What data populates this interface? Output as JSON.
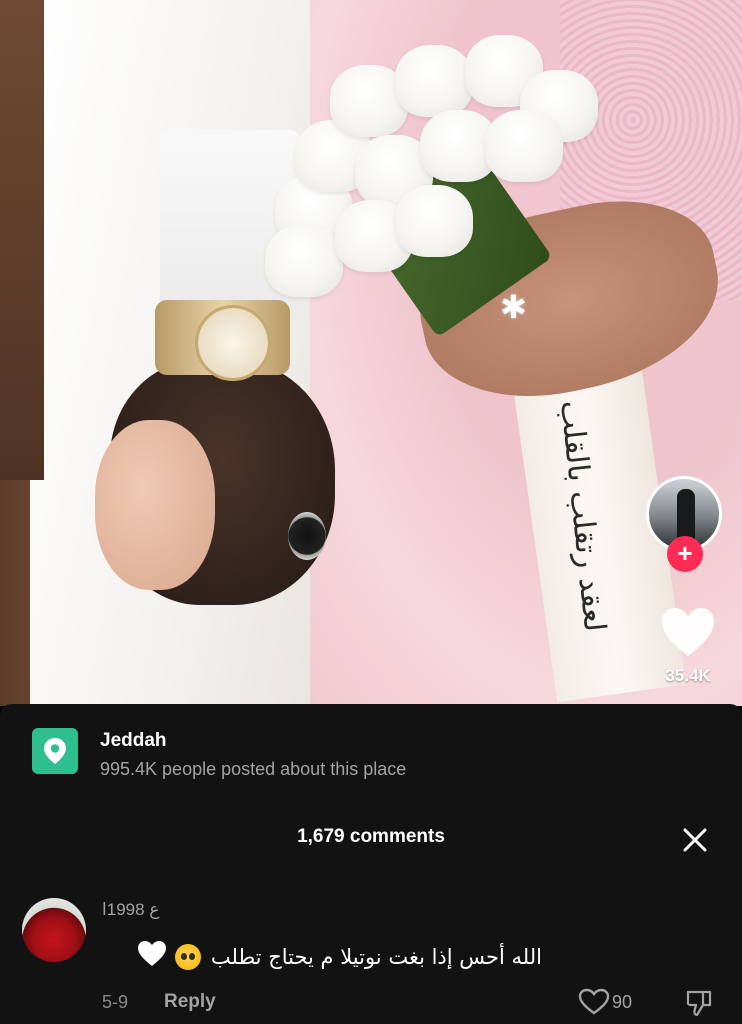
{
  "video": {
    "overlay_text": "لعقد رتقلب بالقلب",
    "profile": {
      "follow_symbol": "+"
    },
    "likes": "35.4K"
  },
  "location": {
    "icon": "location-pin-icon",
    "name": "Jeddah",
    "subtitle": "995.4K people posted about this place"
  },
  "comments": {
    "count_label": "1,679 comments",
    "close_icon": "close-icon",
    "items": [
      {
        "username": "ع 1998ا",
        "text": "الله أحس إذا بغت نوتيلا م يحتاج تطلب",
        "emojis": [
          "pleading-face-emoji",
          "white-heart-emoji"
        ],
        "date": "5-9",
        "reply_label": "Reply",
        "likes": "90"
      }
    ]
  },
  "colors": {
    "sheet_bg": "#121212",
    "accent_red": "#fe2c55",
    "location_green": "#2fbf8f"
  }
}
